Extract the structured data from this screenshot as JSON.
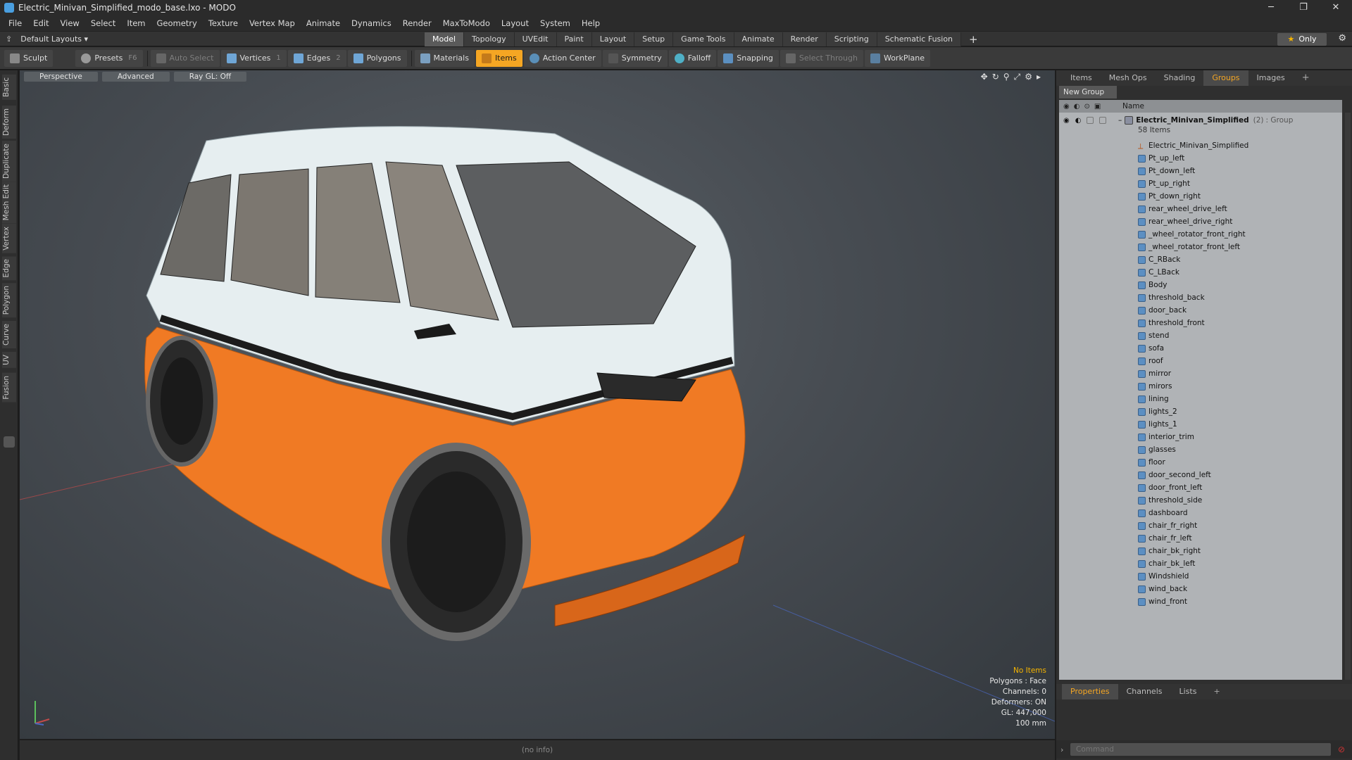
{
  "title": "Electric_Minivan_Simplified_modo_base.lxo - MODO",
  "menu": [
    "File",
    "Edit",
    "View",
    "Select",
    "Item",
    "Geometry",
    "Texture",
    "Vertex Map",
    "Animate",
    "Dynamics",
    "Render",
    "MaxToModo",
    "Layout",
    "System",
    "Help"
  ],
  "layout_name": "Default Layouts ▾",
  "tabs": [
    "Model",
    "Topology",
    "UVEdit",
    "Paint",
    "Layout",
    "Setup",
    "Game Tools",
    "Animate",
    "Render",
    "Scripting",
    "Schematic Fusion"
  ],
  "only_label": "Only",
  "toolbar": {
    "sculpt": "Sculpt",
    "presets": "Presets",
    "presets_key": "F6",
    "auto_select": "Auto Select",
    "vertices": "Vertices",
    "vertices_key": "1",
    "edges": "Edges",
    "edges_key": "2",
    "polygons": "Polygons",
    "materials": "Materials",
    "items": "Items",
    "action_center": "Action Center",
    "symmetry": "Symmetry",
    "falloff": "Falloff",
    "snapping": "Snapping",
    "select_through": "Select Through",
    "workplane": "WorkPlane"
  },
  "left_tabs": [
    "Basic",
    "Deform",
    "Duplicate",
    "Mesh Edit",
    "Vertex",
    "Edge",
    "Polygon",
    "Curve",
    "UV",
    "Fusion"
  ],
  "viewport": {
    "perspective": "Perspective",
    "advanced": "Advanced",
    "raygl": "Ray GL: Off"
  },
  "stats": [
    "No Items",
    "Polygons : Face",
    "Channels: 0",
    "Deformers: ON",
    "GL: 447,000",
    "100 mm"
  ],
  "info": "(no info)",
  "right_tabs": [
    "Items",
    "Mesh Ops",
    "Shading",
    "Groups",
    "Images"
  ],
  "new_group": "New Group",
  "name_header": "Name",
  "group": {
    "name": "Electric_Minivan_Simplified",
    "count": "(2)",
    "type": ": Group",
    "items": "58 Items"
  },
  "items": [
    "Electric_Minivan_Simplified",
    "Pt_up_left",
    "Pt_down_left",
    "Pt_up_right",
    "Pt_down_right",
    "rear_wheel_drive_left",
    "rear_wheel_drive_right",
    "_wheel_rotator_front_right",
    "_wheel_rotator_front_left",
    "C_RBack",
    "C_LBack",
    "Body",
    "threshold_back",
    "door_back",
    "threshold_front",
    "stend",
    "sofa",
    "roof",
    "mirror",
    "mirors",
    "lining",
    "lights_2",
    "lights_1",
    "interior_trim",
    "glasses",
    "floor",
    "door_second_left",
    "door_front_left",
    "threshold_side",
    "dashboard",
    "chair_fr_right",
    "chair_fr_left",
    "chair_bk_right",
    "chair_bk_left",
    "Windshield",
    "wind_back",
    "wind_front"
  ],
  "prop_tabs": [
    "Properties",
    "Channels",
    "Lists"
  ],
  "command_placeholder": "Command",
  "colors": {
    "accent": "#f5a623",
    "van_orange": "#f07a24",
    "van_white": "#e9f1f2"
  }
}
